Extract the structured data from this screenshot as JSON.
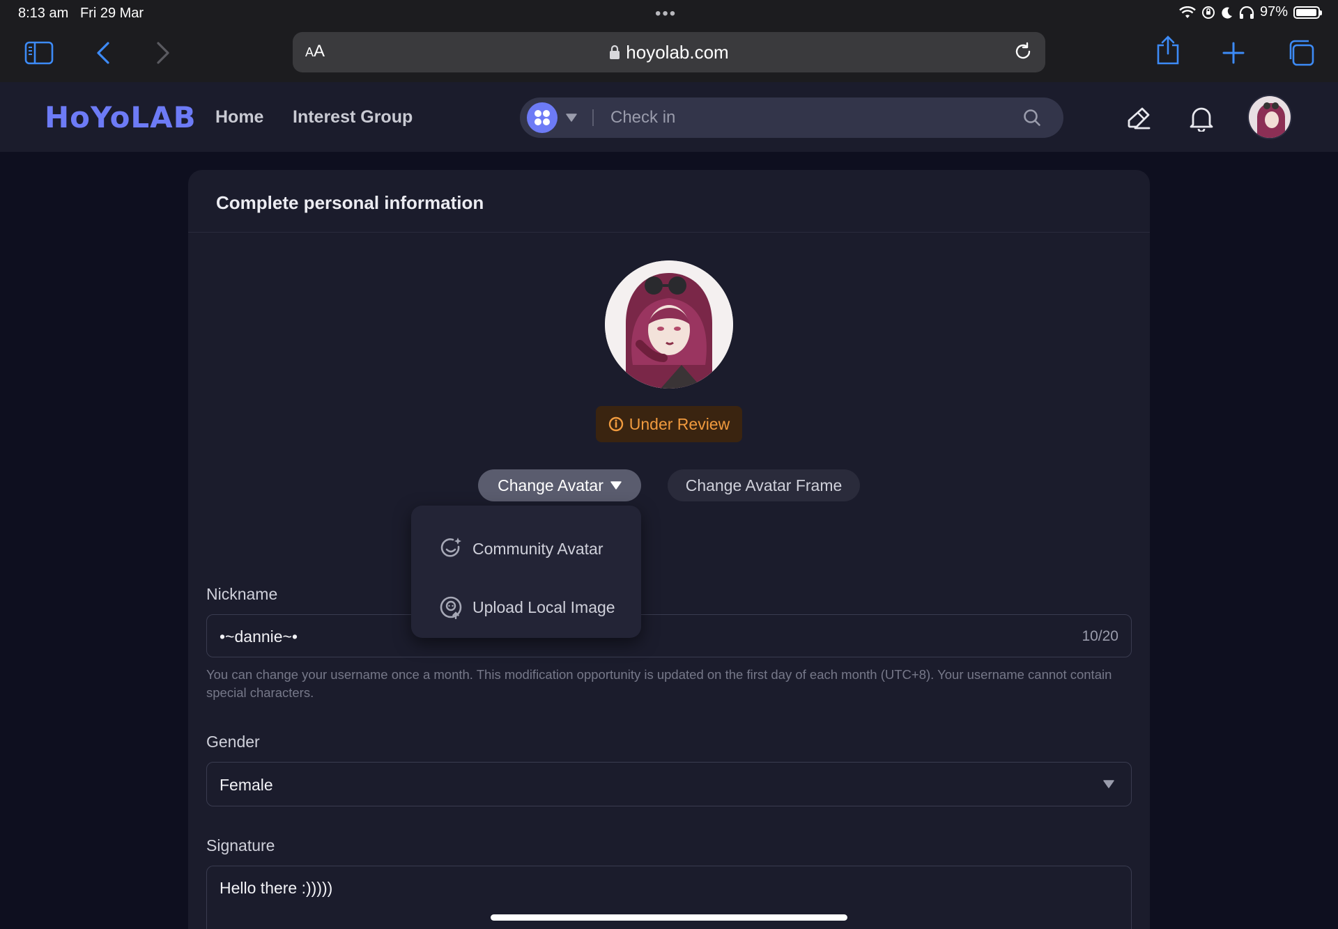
{
  "status_bar": {
    "time": "8:13 am",
    "date": "Fri 29 Mar",
    "battery": "97%",
    "battery_level": 0.97
  },
  "browser": {
    "reader_label_small": "A",
    "reader_label_large": "A",
    "url": "hoyolab.com"
  },
  "site": {
    "logo": "HoYoLAB",
    "nav": {
      "home": "Home",
      "interest_group": "Interest Group"
    },
    "search": {
      "placeholder": "Check in"
    }
  },
  "page": {
    "title": "Complete personal information",
    "review_status": "Under Review",
    "buttons": {
      "change_avatar": "Change Avatar",
      "change_avatar_frame": "Change Avatar Frame"
    },
    "avatar_menu": {
      "community_avatar": "Community Avatar",
      "upload_local_image": "Upload Local Image"
    },
    "nickname": {
      "label": "Nickname",
      "value": "•~dannie~•",
      "counter": "10/20",
      "hint": "You can change your username once a month. This modification opportunity is updated on the first day of each month (UTC+8). Your username cannot contain special characters."
    },
    "gender": {
      "label": "Gender",
      "value": "Female"
    },
    "signature": {
      "label": "Signature",
      "value": "Hello there :)))))"
    }
  },
  "colors": {
    "accent": "#6d7bf6",
    "review": "#f09a3e",
    "background": "#0e0f1f",
    "card": "#1b1c2c"
  }
}
